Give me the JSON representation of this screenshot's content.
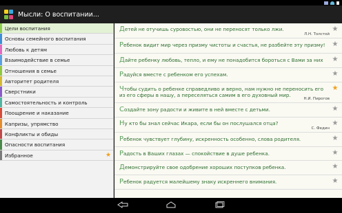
{
  "status_bar": {
    "time": ""
  },
  "app": {
    "title": "Мысли: О воспитании...",
    "icon_colors": [
      "#f7d21c",
      "#39a9e0",
      "#76bd43",
      "#e0457b"
    ]
  },
  "sidebar": {
    "items": [
      {
        "label": "Цели воспитания",
        "color": "#8fcf4f",
        "selected": true
      },
      {
        "label": "Основы семейного воспитания",
        "color": "#3c8fd6"
      },
      {
        "label": "Любовь к детям",
        "color": "#e26ac0"
      },
      {
        "label": "Взаимодействие в семье",
        "color": "#5aa0e0"
      },
      {
        "label": "Отношения в семье",
        "color": "#90c840"
      },
      {
        "label": "Авторитет родителя",
        "color": "#d6b830"
      },
      {
        "label": "Сверстники",
        "color": "#8a5ac8"
      },
      {
        "label": "Самостоятельность и контроль",
        "color": "#50b4a0"
      },
      {
        "label": "Поощрение и наказание",
        "color": "#d84a3a"
      },
      {
        "label": "Капризы, упрямство",
        "color": "#e38d2c"
      },
      {
        "label": "Конфликты и обиды",
        "color": "#c04848"
      },
      {
        "label": "Опасности воспитания",
        "color": "#4a8a48"
      },
      {
        "label": "Избранное",
        "color": "#7a7a7a",
        "star": true
      }
    ]
  },
  "quotes": [
    {
      "first": "Д",
      "rest": "етей не отучишь суровостью, они не переносят только лжи.",
      "author": "Л.Н. Толстой",
      "starred": false
    },
    {
      "first": "Р",
      "rest": "ебенок видит мир через призму чистоты и счастья, не разбейте эту призму!",
      "author": "",
      "starred": false
    },
    {
      "first": "Д",
      "rest": "айте ребенку любовь, тепло, и ему не понадобится бороться с Вами за них",
      "author": "",
      "starred": false
    },
    {
      "first": "Р",
      "rest": "адуйся вместе с ребенком его успехам.",
      "author": "",
      "starred": false
    },
    {
      "first": "Ч",
      "rest": "тобы судить о ребенке справедливо и верно, нам нужно не переносить его из его сферы в нашу, а переселяться самим в его духовный мир.",
      "author": "Н.И. Пирогов",
      "starred": true
    },
    {
      "first": "С",
      "rest": "оздайте зону радости и живите в ней вместе с детьми.",
      "author": "",
      "starred": false
    },
    {
      "first": "Н",
      "rest": "у кто бы знал сейчас Икара, если бы он послушался отца?",
      "author": "С. Федин",
      "starred": false
    },
    {
      "first": "Р",
      "rest": "ебенок чувствует глубину, искренность особенно, слова родителя.",
      "author": "",
      "starred": false
    },
    {
      "first": "Р",
      "rest": "адость в Ваших глазах — спокойствие в душе ребенка.",
      "author": "",
      "starred": false
    },
    {
      "first": "Д",
      "rest": "емонстрируйте свое одобрение хороших поступков ребенка.",
      "author": "",
      "starred": false
    },
    {
      "first": "Р",
      "rest": "ебенок радуется малейшему знаку искреннего внимания.",
      "author": "",
      "starred": false
    }
  ],
  "icons": {
    "star": "★",
    "nav_back": "back-icon",
    "nav_home": "home-icon",
    "nav_recent": "recent-apps-icon"
  }
}
